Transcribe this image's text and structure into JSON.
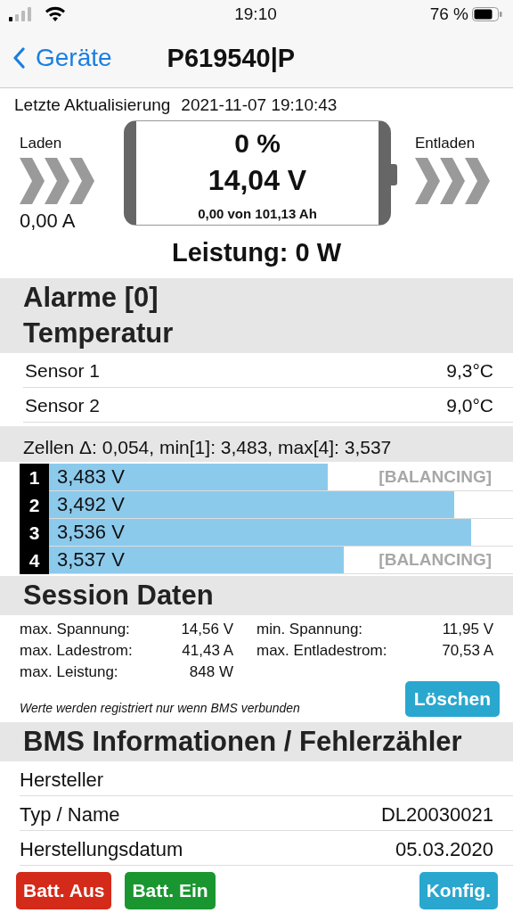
{
  "status_bar": {
    "time": "19:10",
    "battery": "76 %"
  },
  "nav": {
    "back": "Geräte",
    "title": "P619540|P"
  },
  "update": {
    "label": "Letzte Aktualisierung",
    "value": "2021-11-07 19:10:43"
  },
  "battery": {
    "charge_label": "Laden",
    "charge_current": "0,00 A",
    "discharge_label": "Entladen",
    "percent": "0 %",
    "voltage": "14,04 V",
    "capacity": "0,00 von 101,13 Ah",
    "power": "Leistung: 0 W"
  },
  "alarms": {
    "title": "Alarme [0]"
  },
  "temperature": {
    "title": "Temperatur",
    "sensors": [
      {
        "name": "Sensor 1",
        "value": "9,3°C"
      },
      {
        "name": "Sensor 2",
        "value": "9,0°C"
      }
    ]
  },
  "cells": {
    "summary": "Zellen Δ: 0,054, min[1]: 3,483, max[4]: 3,537",
    "items": [
      {
        "index": "1",
        "voltage": "3,483 V",
        "level": 0.6,
        "status": "[BALANCING]"
      },
      {
        "index": "2",
        "voltage": "3,492 V",
        "level": 0.873
      },
      {
        "index": "3",
        "voltage": "3,536 V",
        "level": 0.91
      },
      {
        "index": "4",
        "voltage": "3,537 V",
        "level": 0.635,
        "status": "[BALANCING]"
      }
    ]
  },
  "session": {
    "title": "Session Daten",
    "stats": [
      {
        "label": "max. Spannung:",
        "value": "14,56 V"
      },
      {
        "label": "min. Spannung:",
        "value": "11,95 V"
      },
      {
        "label": "max. Ladestrom:",
        "value": "41,43 A"
      },
      {
        "label": "max. Entladestrom:",
        "value": "70,53 A"
      },
      {
        "label": "max. Leistung:",
        "value": "848 W"
      }
    ],
    "note": "Werte werden registriert nur wenn BMS verbunden",
    "clear_button": "Löschen"
  },
  "bms": {
    "title": "BMS Informationen / Fehlerzähler",
    "rows": [
      {
        "label": "Hersteller"
      },
      {
        "label": "Typ / Name",
        "value": "DL20030021"
      },
      {
        "label": "Herstellungsdatum",
        "value": "05.03.2020"
      }
    ]
  },
  "buttons": [
    {
      "label": "Batt. Aus",
      "kind": "danger"
    },
    {
      "label": "Batt. Ein",
      "kind": "success"
    },
    {
      "label": "Konfig.",
      "kind": "info"
    }
  ]
}
